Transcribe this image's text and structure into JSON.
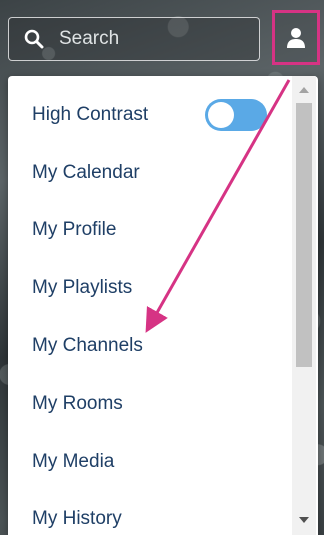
{
  "header": {
    "search": {
      "placeholder": "Search",
      "value": "",
      "icon": "search-icon"
    },
    "user_button": {
      "icon": "user-icon",
      "highlight_color": "#d63384"
    }
  },
  "menu": {
    "toggle": {
      "label": "High Contrast",
      "on": true,
      "color": "#5aa9e6"
    },
    "items": [
      {
        "label": "My Calendar"
      },
      {
        "label": "My Profile"
      },
      {
        "label": "My Playlists"
      },
      {
        "label": "My Channels"
      },
      {
        "label": "My Rooms"
      },
      {
        "label": "My Media"
      },
      {
        "label": "My History"
      }
    ],
    "text_color": "#1f3f66"
  },
  "scrollbar": {
    "position": 0.0
  },
  "annotation": {
    "type": "arrow",
    "color": "#d63384",
    "from": "user-button",
    "to": "menu-item-my-channels"
  }
}
